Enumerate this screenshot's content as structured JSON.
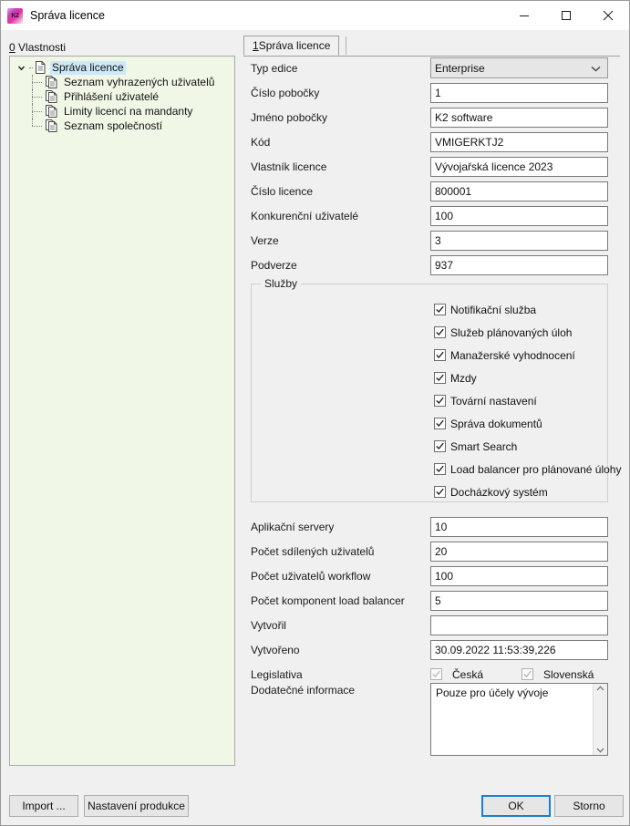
{
  "window": {
    "title": "Správa licence",
    "icon": "k2-app-icon",
    "controls": {
      "minimize": "minimize-icon",
      "maximize": "maximize-icon",
      "close": "close-icon"
    }
  },
  "left": {
    "header_accel": "0",
    "header_label": " Vlastnosti",
    "tree": {
      "root": "Správa licence",
      "children": [
        "Seznam vyhrazených uživatelů",
        "Přihlášení uživatelé",
        "Limity licencí na mandanty",
        "Seznam společností"
      ]
    }
  },
  "tabs": [
    {
      "accel": "1",
      "label": " Správa licence"
    }
  ],
  "form": {
    "fields": [
      {
        "label": "Typ edice",
        "value": "Enterprise",
        "type": "combo"
      },
      {
        "label": "Číslo pobočky",
        "value": "1",
        "type": "text"
      },
      {
        "label": "Jméno pobočky",
        "value": "K2 software",
        "type": "text"
      },
      {
        "label": "Kód",
        "value": "VMIGERKTJ2",
        "type": "text"
      },
      {
        "label": "Vlastník licence",
        "value": "Vývojařská licence 2023",
        "type": "text"
      },
      {
        "label": "Číslo licence",
        "value": "800001",
        "type": "text"
      },
      {
        "label": "Konkurenční uživatelé",
        "value": "100",
        "type": "text"
      },
      {
        "label": "Verze",
        "value": "3",
        "type": "text"
      },
      {
        "label": "Podverze",
        "value": "937",
        "type": "text"
      }
    ],
    "services_group": {
      "title": "Služby",
      "items": [
        {
          "label": "Notifikační služba",
          "checked": true
        },
        {
          "label": "Služeb plánovaných úloh",
          "checked": true
        },
        {
          "label": "Manažerské vyhodnocení",
          "checked": true
        },
        {
          "label": "Mzdy",
          "checked": true
        },
        {
          "label": "Tovární nastavení",
          "checked": true
        },
        {
          "label": "Správa dokumentů",
          "checked": true
        },
        {
          "label": "Smart Search",
          "checked": true
        },
        {
          "label": "Load balancer pro plánované úlohy",
          "checked": true
        },
        {
          "label": "Docházkový systém",
          "checked": true
        }
      ]
    },
    "fields2": [
      {
        "label": "Aplikační servery",
        "value": "10"
      },
      {
        "label": "Počet sdílených uživatelů",
        "value": "20"
      },
      {
        "label": "Počet uživatelů workflow",
        "value": "100"
      },
      {
        "label": "Počet komponent load balancer",
        "value": "5"
      },
      {
        "label": "Vytvořil",
        "value": ""
      },
      {
        "label": "Vytvořeno",
        "value": "30.09.2022 11:53:39,226"
      }
    ],
    "legislation": {
      "label": "Legislativa",
      "options": [
        {
          "label": "Česká",
          "checked": true,
          "disabled": true
        },
        {
          "label": "Slovenská",
          "checked": true,
          "disabled": true
        }
      ]
    },
    "extra_info": {
      "label": "Dodatečné informace",
      "value": "Pouze pro účely vývoje"
    }
  },
  "footer": {
    "import": "Import ...",
    "production_settings": "Nastavení produkce",
    "ok": "OK",
    "cancel": "Storno"
  },
  "colors": {
    "tree_background": "#f1f7e7",
    "selection": "#cde8f6",
    "focus_border": "#1a7fd4",
    "dialog_background": "#f0f0f0"
  }
}
